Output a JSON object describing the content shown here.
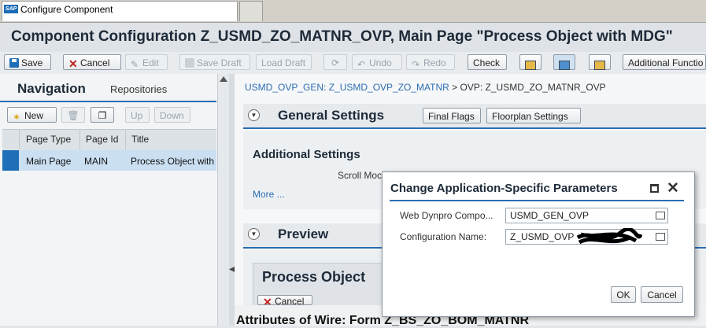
{
  "browser": {
    "tab_title": "Configure Component",
    "logo_text": "SAP"
  },
  "page": {
    "title": "Component Configuration Z_USMD_ZO_MATNR_OVP, Main Page \"Process Object with MDG\""
  },
  "toolbar": {
    "save": "Save",
    "cancel": "Cancel",
    "edit": "Edit",
    "save_draft": "Save Draft",
    "load_draft": "Load Draft",
    "undo": "Undo",
    "redo": "Redo",
    "check": "Check",
    "additional_functions": "Additional Functio"
  },
  "navigation": {
    "title": "Navigation",
    "repositories": "Repositories",
    "new_button": "New",
    "up_button": "Up",
    "down_button": "Down",
    "columns": [
      "Page Type",
      "Page Id",
      "Title"
    ],
    "rows": [
      {
        "page_type": "Main Page",
        "page_id": "MAIN",
        "title": "Process Object with"
      }
    ]
  },
  "breadcrumb": {
    "link": "USMD_OVP_GEN: Z_USMD_OVP_ZO_MATNR",
    "separator": ">",
    "current": "OVP: Z_USMD_ZO_MATNR_OVP"
  },
  "general_settings": {
    "title": "General Settings",
    "final_flags": "Final Flags",
    "floorplan_settings": "Floorplan Settings",
    "additional_settings": "Additional Settings",
    "scroll_label": "Scroll Moc",
    "more_link": "More ..."
  },
  "preview": {
    "title": "Preview",
    "process_object": "Process Object",
    "cancel": "Cancel"
  },
  "wire": {
    "text": "Attributes of Wire: Form Z_BS_ZO_BOM_MATNR"
  },
  "dialog": {
    "title": "Change Application-Specific Parameters",
    "fields": [
      {
        "label": "Web Dynpro Compo...",
        "value": "USMD_GEN_OVP"
      },
      {
        "label": "Configuration Name:",
        "value": "Z_USMD_OVP"
      }
    ],
    "ok": "OK",
    "cancel": "Cancel"
  }
}
